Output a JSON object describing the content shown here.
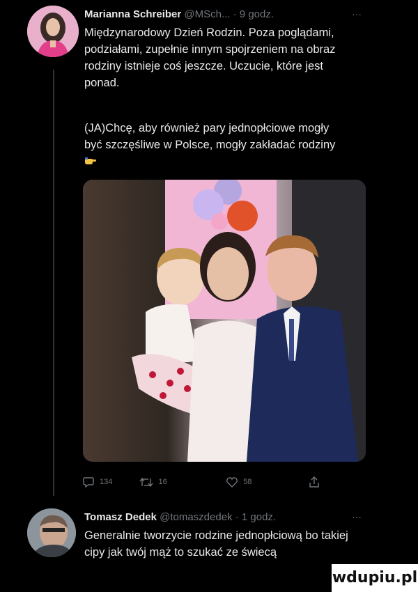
{
  "tweet1": {
    "name": "Marianna Schreiber",
    "handle": "@MSch...",
    "time": "· 9 godz.",
    "more": "···",
    "text1": "Międzynarodowy Dzień Rodzin. Poza poglądami, podziałami, zupełnie innym spojrzeniem na obraz rodziny istnieje coś jeszcze. Uczucie, które jest ponad.",
    "text2": "(JA)Chcę, aby również pary jednopłciowe mogły być szczęśliwe w Polsce, mogły zakładać rodziny",
    "emoji": "backhand-index-pointing-down-icon",
    "photo_description_alt": "",
    "actions": {
      "replies": "134",
      "retweets": "16",
      "likes": "58"
    }
  },
  "tweet2": {
    "name": "Tomasz Dedek",
    "handle": "@tomaszdedek",
    "time": "· 1 godz.",
    "more": "···",
    "text": "Generalnie tworzycie rodzine jednopłciową bo takiej cipy jak twój mąż to szukać ze świecą"
  },
  "watermark": "wdupiu.pl",
  "colors": {
    "background": "#000000",
    "text": "#e7e9ea",
    "muted": "#71767b"
  }
}
